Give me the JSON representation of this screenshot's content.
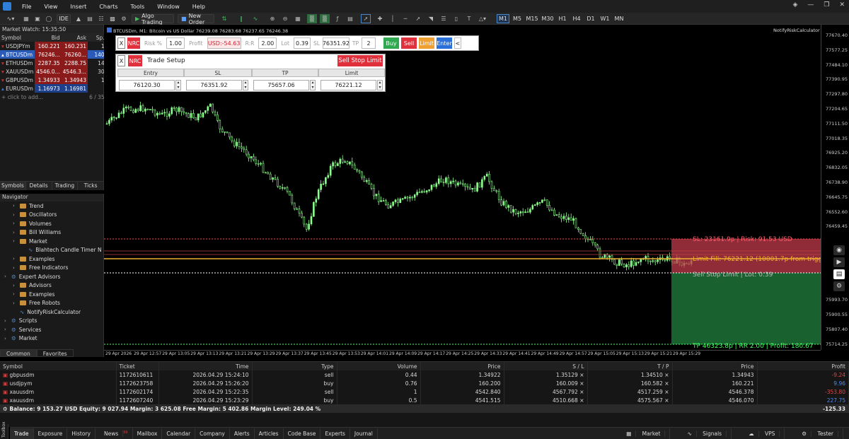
{
  "menu": [
    "File",
    "View",
    "Insert",
    "Charts",
    "Tools",
    "Window",
    "Help"
  ],
  "toolbar": {
    "ide": "IDE",
    "algo": "Algo Trading",
    "neworder": "New Order",
    "timeframes": [
      "M1",
      "M5",
      "M15",
      "M30",
      "H1",
      "H4",
      "D1",
      "W1",
      "MN"
    ],
    "active_tf": "M1"
  },
  "market_watch": {
    "title": "Market Watch: 15:35:50",
    "headers": [
      "Symbol",
      "Bid",
      "Ask",
      "Sp..."
    ],
    "rows": [
      {
        "symbol": "USDJPYm",
        "bid": "160.221",
        "ask": "160.231",
        "spread": "10"
      },
      {
        "symbol": "BTCUSDm",
        "bid": "76246...",
        "ask": "76260...",
        "spread": "1400"
      },
      {
        "symbol": "ETHUSDm",
        "bid": "2287.35",
        "ask": "2288.75",
        "spread": "140"
      },
      {
        "symbol": "XAUUSDm",
        "bid": "4546.0...",
        "ask": "4546.3...",
        "spread": "308"
      },
      {
        "symbol": "GBPUSDm",
        "bid": "1.34933",
        "ask": "1.34943",
        "spread": "10"
      },
      {
        "symbol": "EURUSDm",
        "bid": "1.16973",
        "ask": "1.16981",
        "spread": "8"
      }
    ],
    "add": "click to add...",
    "count": "6 / 351",
    "tabs": [
      "Symbols",
      "Details",
      "Trading",
      "Ticks"
    ]
  },
  "navigator": {
    "title": "Navigator",
    "items": [
      {
        "label": "Trend",
        "indent": 1,
        "type": "folder"
      },
      {
        "label": "Oscillators",
        "indent": 1,
        "type": "folder"
      },
      {
        "label": "Volumes",
        "indent": 1,
        "type": "folder"
      },
      {
        "label": "Bill Williams",
        "indent": 1,
        "type": "folder"
      },
      {
        "label": "Market",
        "indent": 1,
        "type": "folder"
      },
      {
        "label": "Blahtech Candle Timer N",
        "indent": 2,
        "type": "item"
      },
      {
        "label": "Examples",
        "indent": 1,
        "type": "folder"
      },
      {
        "label": "Free Indicators",
        "indent": 1,
        "type": "folder"
      },
      {
        "label": "Expert Advisors",
        "indent": 0,
        "type": "root"
      },
      {
        "label": "Advisors",
        "indent": 1,
        "type": "folder"
      },
      {
        "label": "Examples",
        "indent": 1,
        "type": "folder"
      },
      {
        "label": "Free Robots",
        "indent": 1,
        "type": "folder"
      },
      {
        "label": "NotifyRiskCalculator",
        "indent": 1,
        "type": "item"
      },
      {
        "label": "Scripts",
        "indent": 0,
        "type": "root"
      },
      {
        "label": "Services",
        "indent": 0,
        "type": "root"
      },
      {
        "label": "Market",
        "indent": 0,
        "type": "root"
      }
    ],
    "tabs": [
      "Common",
      "Favorites"
    ]
  },
  "chart": {
    "header": "BTCUSDm, M1: Bitcoin vs US Dollar 76239.08 76283.68 76237.65 76246.38",
    "indicator": "NotifyRiskCalculator",
    "price_labels": [
      "77670.40",
      "77577.25",
      "77484.10",
      "77390.95",
      "77297.80",
      "77204.65",
      "77111.50",
      "77018.35",
      "76925.20",
      "76832.05",
      "76738.90",
      "76645.75",
      "76552.60",
      "76459.45",
      "",
      "",
      "",
      "",
      "75993.70",
      "75900.55",
      "75807.40",
      "75714.25"
    ],
    "time_labels": [
      "29 Apr 2026",
      "29 Apr 12:57",
      "29 Apr 13:05",
      "29 Apr 13:13",
      "29 Apr 13:21",
      "29 Apr 13:29",
      "29 Apr 13:37",
      "29 Apr 13:45",
      "29 Apr 13:53",
      "29 Apr 14:01",
      "29 Apr 14:09",
      "29 Apr 14:17",
      "29 Apr 14:25",
      "29 Apr 14:33",
      "29 Apr 14:41",
      "29 Apr 14:49",
      "29 Apr 14:57",
      "29 Apr 15:05",
      "29 Apr 15:13",
      "29 Apr 15:21",
      "29 Apr 15:29"
    ],
    "sl_text": "SL: 23161.9p | Risk: 91.53 USD",
    "limit_text": "Limit Fill: 76221.12 (10001.7p from trigg",
    "entry_text": "Sell Stop Limit | Lot: 0.39",
    "tp_text": "TP 46323.8p | RR 2.00 | Profit: 180.67",
    "tp_price": "75657.06"
  },
  "nrc": {
    "x": "X",
    "nrc": "NRC",
    "risk_label": "Risk %",
    "risk": "1.00",
    "profit_label": "Profit",
    "usd": "USD:-54.63",
    "rr_label": "R:R",
    "rr": "2.00",
    "lot_label": "Lot",
    "lot": "0.39",
    "sl_label": "SL",
    "sl": "76351.92",
    "tp_label": "TP",
    "tp": "2",
    "buy": "Buy",
    "sell": "Sell",
    "limit": "Limit",
    "enter": "Enter",
    "collapse": "<"
  },
  "setup": {
    "title": "Trade Setup",
    "action": "Sell Stop Limit",
    "cols": [
      "Entry",
      "SL",
      "TP",
      "Limit"
    ],
    "vals": [
      "76120.30",
      "76351.92",
      "75657.06",
      "76221.12"
    ]
  },
  "positions": {
    "headers": [
      "Symbol",
      "Ticket",
      "Time",
      "Type",
      "Volume",
      "Price",
      "S / L",
      "T / P",
      "Price",
      "Profit"
    ],
    "rows": [
      {
        "symbol": "gbpusdm",
        "ticket": "1172610611",
        "time": "2026.04.29 15:24:10",
        "type": "sell",
        "volume": "0.44",
        "price": "1.34922",
        "sl": "1.35129",
        "tp": "1.34510",
        "cur": "1.34943",
        "profit": "-9.24"
      },
      {
        "symbol": "usdjpym",
        "ticket": "1172623758",
        "time": "2026.04.29 15:26:20",
        "type": "buy",
        "volume": "0.76",
        "price": "160.200",
        "sl": "160.009",
        "tp": "160.582",
        "cur": "160.221",
        "profit": "9.96"
      },
      {
        "symbol": "xauusdm",
        "ticket": "1172602174",
        "time": "2026.04.29 15:22:35",
        "type": "sell",
        "volume": "1",
        "price": "4542.840",
        "sl": "4567.792",
        "tp": "4517.259",
        "cur": "4546.378",
        "profit": "-353.80"
      },
      {
        "symbol": "xauusdm",
        "ticket": "1172607240",
        "time": "2026.04.29 15:23:29",
        "type": "buy",
        "volume": "0.5",
        "price": "4541.515",
        "sl": "4510.668",
        "tp": "4575.567",
        "cur": "4546.070",
        "profit": "227.75"
      }
    ],
    "balance": "Balance: 9 153.27 USD  Equity: 9 027.94  Margin: 3 625.08  Free Margin: 5 402.86  Margin Level: 249.04 %",
    "total": "-125.33"
  },
  "bottom_tabs": [
    "Trade",
    "Exposure",
    "History",
    "News",
    "Mailbox",
    "Calendar",
    "Company",
    "Alerts",
    "Articles",
    "Code Base",
    "Experts",
    "Journal"
  ],
  "news_badge": "99",
  "status_right": [
    "Market",
    "Signals",
    "VPS",
    "Tester"
  ],
  "toolbox_label": "Toolbox"
}
